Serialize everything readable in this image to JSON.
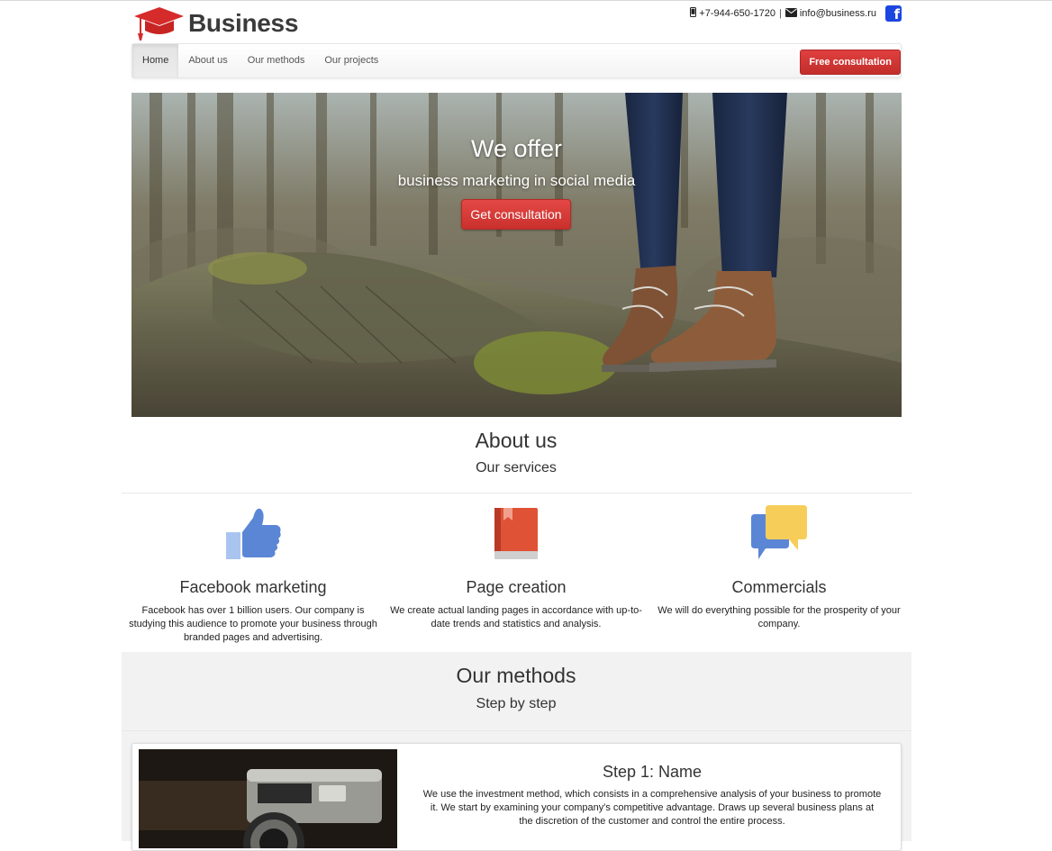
{
  "brand": {
    "name": "Business",
    "logo_icon": "graduation-cap-icon",
    "logo_color": "#d62b2b"
  },
  "contacts": {
    "phone": "+7-944-650-1720",
    "separator": "|",
    "email": "info@business.ru",
    "facebook_icon": "facebook-icon"
  },
  "nav": {
    "items": [
      {
        "label": "Home",
        "active": true
      },
      {
        "label": "About us",
        "active": false
      },
      {
        "label": "Our methods",
        "active": false
      },
      {
        "label": "Our projects",
        "active": false
      }
    ],
    "cta_label": "Free consultation"
  },
  "hero": {
    "title": "We offer",
    "subtitle": "business marketing in social media",
    "button_label": "Get consultation"
  },
  "about": {
    "title": "About us",
    "subtitle": "Our services",
    "services": [
      {
        "icon": "thumbs-up-icon",
        "title": "Facebook marketing",
        "text": "Facebook has over 1 billion users. Our company is studying this audience to promote your business through branded pages and advertising."
      },
      {
        "icon": "book-icon",
        "title": "Page creation",
        "text": "We create actual landing pages in accordance with up-to-date trends and statistics and analysis."
      },
      {
        "icon": "chat-bubbles-icon",
        "title": "Commercials",
        "text": "We will do everything possible for the prosperity of your company."
      }
    ]
  },
  "methods": {
    "title": "Our methods",
    "subtitle": "Step by step",
    "steps": [
      {
        "title": "Step 1: Name",
        "text": "We use the investment method, which consists in a comprehensive analysis of your business to promote it. We start by examining your company's competitive advantage. Draws up several business plans at the discretion of the customer and control the entire process."
      }
    ]
  },
  "colors": {
    "accent_red": "#d43f3a",
    "facebook_blue": "#1b46e0",
    "methods_bg": "#f2f2f2"
  }
}
